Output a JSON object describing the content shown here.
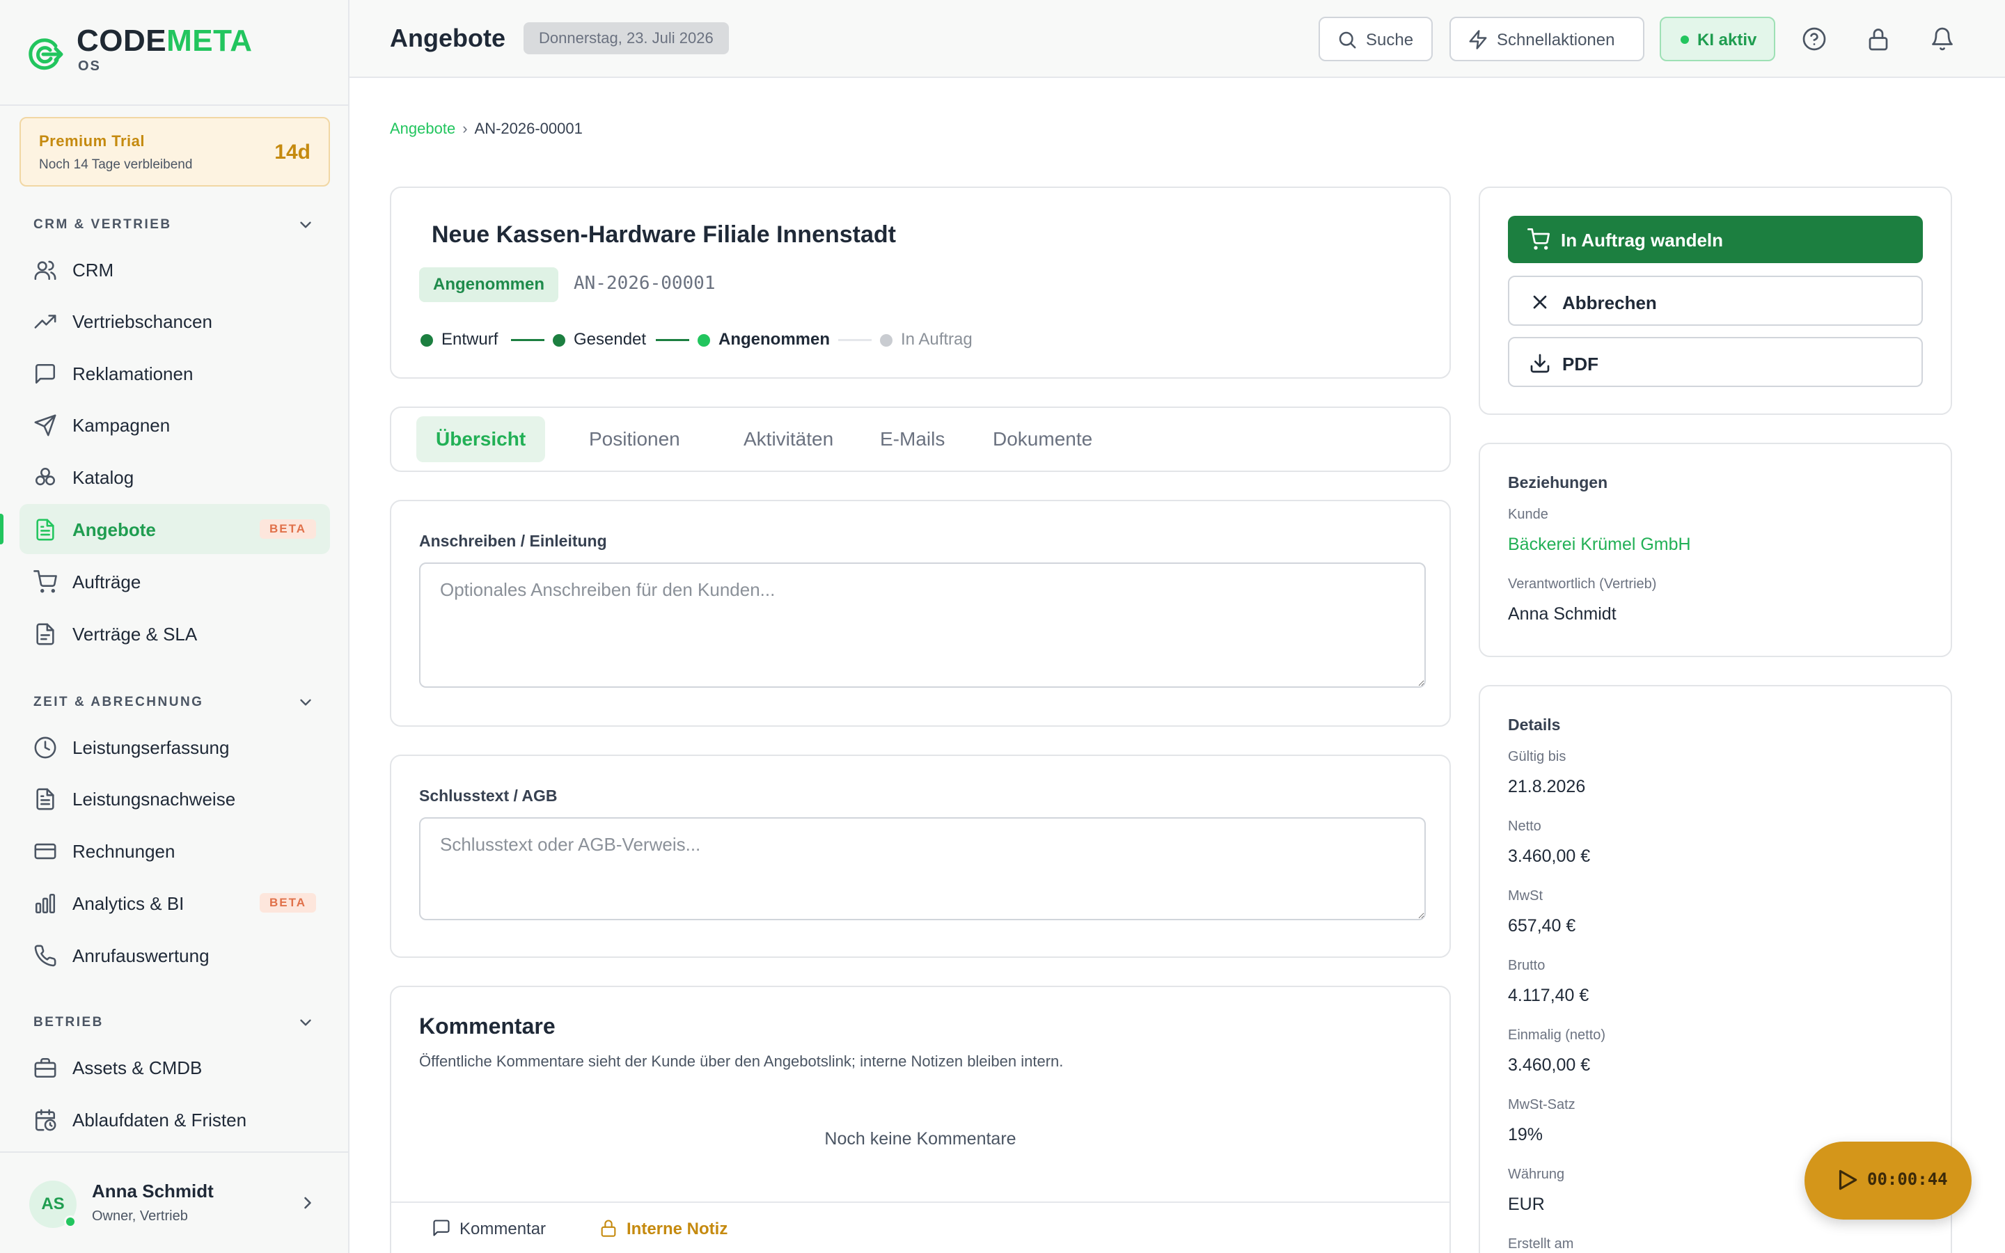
{
  "app": {
    "logo_part1": "CODE",
    "logo_part2": "META",
    "logo_sub": "OS"
  },
  "trial": {
    "title": "Premium Trial",
    "subtitle": "Noch 14 Tage verbleibend",
    "days": "14d"
  },
  "sidebar": {
    "sections": [
      {
        "title": "CRM & VERTRIEB",
        "items": [
          {
            "label": "CRM",
            "icon": "users-icon"
          },
          {
            "label": "Vertriebschancen",
            "icon": "trending-up-icon"
          },
          {
            "label": "Reklamationen",
            "icon": "message-square-icon"
          },
          {
            "label": "Kampagnen",
            "icon": "send-icon"
          },
          {
            "label": "Katalog",
            "icon": "boxes-icon"
          },
          {
            "label": "Angebote",
            "icon": "file-text-icon",
            "active": true,
            "badge": "BETA"
          },
          {
            "label": "Aufträge",
            "icon": "cart-icon"
          },
          {
            "label": "Verträge & SLA",
            "icon": "file-icon"
          }
        ]
      },
      {
        "title": "ZEIT & ABRECHNUNG",
        "items": [
          {
            "label": "Leistungserfassung",
            "icon": "clock-icon"
          },
          {
            "label": "Leistungsnachweise",
            "icon": "file-text-icon"
          },
          {
            "label": "Rechnungen",
            "icon": "credit-card-icon"
          },
          {
            "label": "Analytics & BI",
            "icon": "bar-chart-icon",
            "badge": "BETA"
          },
          {
            "label": "Anrufauswertung",
            "icon": "phone-icon"
          }
        ]
      },
      {
        "title": "BETRIEB",
        "items": [
          {
            "label": "Assets & CMDB",
            "icon": "briefcase-icon"
          },
          {
            "label": "Ablaufdaten & Fristen",
            "icon": "calendar-clock-icon"
          }
        ]
      }
    ]
  },
  "user": {
    "initials": "AS",
    "name": "Anna Schmidt",
    "role": "Owner, Vertrieb"
  },
  "header": {
    "title": "Angebote",
    "date": "Donnerstag, 23. Juli 2026",
    "search_label": "Suche",
    "quick_actions_label": "Schnellaktionen",
    "ai_label": "KI aktiv"
  },
  "breadcrumb": {
    "parent": "Angebote",
    "separator": "›",
    "current": "AN-2026-00001"
  },
  "offer": {
    "title": "Neue Kassen-Hardware Filiale Innenstadt",
    "status": "Angenommen",
    "number": "AN-2026-00001",
    "steps": [
      {
        "label": "Entwurf",
        "state": "done"
      },
      {
        "label": "Gesendet",
        "state": "done"
      },
      {
        "label": "Angenommen",
        "state": "current"
      },
      {
        "label": "In Auftrag",
        "state": "pending"
      }
    ]
  },
  "tabs": [
    "Übersicht",
    "Positionen",
    "Aktivitäten",
    "E-Mails",
    "Dokumente"
  ],
  "form": {
    "intro_label": "Anschreiben / Einleitung",
    "intro_placeholder": "Optionales Anschreiben für den Kunden...",
    "closing_label": "Schlusstext / AGB",
    "closing_placeholder": "Schlusstext oder AGB-Verweis..."
  },
  "comments": {
    "title": "Kommentare",
    "subtitle": "Öffentliche Kommentare sieht der Kunde über den Angebotslink; interne Notizen bleiben intern.",
    "empty": "Noch keine Kommentare",
    "tab_comment": "Kommentar",
    "tab_internal": "Interne Notiz"
  },
  "actions": {
    "convert": "In Auftrag wandeln",
    "cancel": "Abbrechen",
    "pdf": "PDF"
  },
  "relations": {
    "title": "Beziehungen",
    "customer_label": "Kunde",
    "customer": "Bäckerei Krümel GmbH",
    "owner_label": "Verantwortlich (Vertrieb)",
    "owner": "Anna Schmidt"
  },
  "details": {
    "title": "Details",
    "rows": [
      {
        "label": "Gültig bis",
        "value": "21.8.2026"
      },
      {
        "label": "Netto",
        "value": "3.460,00 €"
      },
      {
        "label": "MwSt",
        "value": "657,40 €"
      },
      {
        "label": "Brutto",
        "value": "4.117,40 €"
      },
      {
        "label": "Einmalig (netto)",
        "value": "3.460,00 €"
      },
      {
        "label": "MwSt-Satz",
        "value": "19%"
      },
      {
        "label": "Währung",
        "value": "EUR"
      },
      {
        "label": "Erstellt am",
        "value": ""
      }
    ]
  },
  "timer": {
    "value": "00:00:44"
  },
  "colors": {
    "accent": "#22c55e",
    "primary_button": "#1c7f40",
    "warning": "#d4961a",
    "beta_badge": "#e0714a"
  }
}
